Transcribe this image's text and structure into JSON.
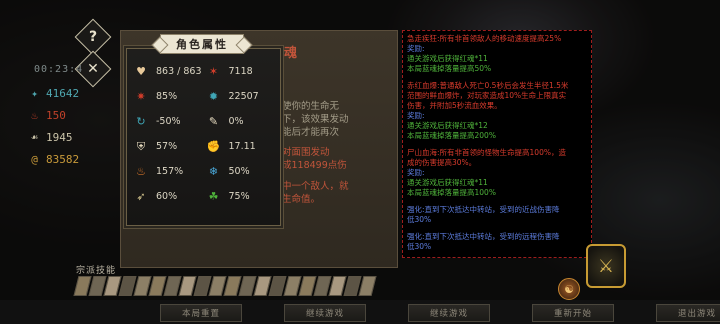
{
  "hud": {
    "help_glyph": "?",
    "close_glyph": "✕",
    "timer": "00:23:4",
    "resources": [
      {
        "icon": "soul-flame-icon",
        "value": "41642",
        "color": "#4fa7b0"
      },
      {
        "icon": "fire-icon",
        "value": "150",
        "color": "#c0412a"
      },
      {
        "icon": "bone-icon",
        "value": "1945",
        "color": "#c9c2a8"
      },
      {
        "icon": "gold-swirl-icon",
        "value": "83582",
        "color": "#c89a3a"
      }
    ]
  },
  "book": {
    "title": "魂",
    "lines_a": [
      "使你的生命无",
      "下，该效果发动",
      "能后才能再次"
    ],
    "lines_b": [
      "对面围发动",
      "成118499点伤"
    ],
    "lines_c": [
      "中一个敌人，就",
      "生命值。"
    ]
  },
  "stats": {
    "header": "角色属性",
    "items": [
      {
        "icon": "heart-icon",
        "value": "863 / 863",
        "color": "#e8c99a"
      },
      {
        "icon": "attack-icon",
        "value": "7118",
        "color": "#d23d2a"
      },
      {
        "icon": "crit-icon",
        "value": "85%",
        "color": "#d23d2a"
      },
      {
        "icon": "crit-damage-icon",
        "value": "22507",
        "color": "#3fa5b5"
      },
      {
        "icon": "cooldown-icon",
        "value": "-50%",
        "color": "#3fa5b5"
      },
      {
        "icon": "scroll-icon",
        "value": "0%",
        "color": "#e8dcc0"
      },
      {
        "icon": "shield-icon",
        "value": "57%",
        "color": "#e8dcc0"
      },
      {
        "icon": "strength-icon",
        "value": "17.11",
        "color": "#e8dcc0"
      },
      {
        "icon": "burn-icon",
        "value": "157%",
        "color": "#e07a2a"
      },
      {
        "icon": "frost-icon",
        "value": "50%",
        "color": "#4aa8d8"
      },
      {
        "icon": "dash-icon",
        "value": "60%",
        "color": "#d8c890"
      },
      {
        "icon": "poison-icon",
        "value": "75%",
        "color": "#4fb33b"
      }
    ]
  },
  "tooltip": {
    "sections": [
      {
        "lines": [
          {
            "text": "急走疾狂:所有非首领敌人的移动速度提高25%",
            "cls": "tt-red"
          },
          {
            "text": "奖励:",
            "cls": "tt-blue"
          },
          {
            "text": "通关游戏后获得红魂*11",
            "cls": "tt-grn"
          },
          {
            "text": "本局蓝魂掉落量提高50%",
            "cls": "tt-grn"
          }
        ]
      },
      {
        "lines": [
          {
            "text": "赤红血爆:普通敌人死亡0.5秒后会发生半径1.5米",
            "cls": "tt-red"
          },
          {
            "text": "范围的鲜血爆炸，对玩家造成10%生命上限真实",
            "cls": "tt-red"
          },
          {
            "text": "伤害，并附加5秒流血效果。",
            "cls": "tt-red"
          },
          {
            "text": "奖励:",
            "cls": "tt-blue"
          },
          {
            "text": "通关游戏后获得红魂*12",
            "cls": "tt-grn"
          },
          {
            "text": "本局蓝魂掉落量提高200%",
            "cls": "tt-grn"
          }
        ]
      },
      {
        "lines": [
          {
            "text": "尸山血海:所有非首领的怪物生命提高100%，造",
            "cls": "tt-red"
          },
          {
            "text": "成的伤害提高30%。",
            "cls": "tt-red"
          },
          {
            "text": "奖励:",
            "cls": "tt-blue"
          },
          {
            "text": "通关游戏后获得红魂*11",
            "cls": "tt-grn"
          },
          {
            "text": "本局蓝魂掉落量提高100%",
            "cls": "tt-grn"
          }
        ]
      },
      {
        "lines": [
          {
            "text": "强化:直到下次抵达中转站，受到的近战伤害降",
            "cls": "tt-blue"
          },
          {
            "text": "低30%",
            "cls": "tt-blue"
          }
        ]
      },
      {
        "lines": [
          {
            "text": "强化:直到下次抵达中转站，受到的远程伤害降",
            "cls": "tt-blue"
          },
          {
            "text": "低30%",
            "cls": "tt-blue"
          }
        ]
      }
    ]
  },
  "skills": {
    "title": "宗派技能",
    "count": 20
  },
  "bottom": {
    "buttons": [
      "本局重置",
      "继续游戏",
      "继续游戏",
      "重新开始",
      "退出游戏"
    ]
  }
}
